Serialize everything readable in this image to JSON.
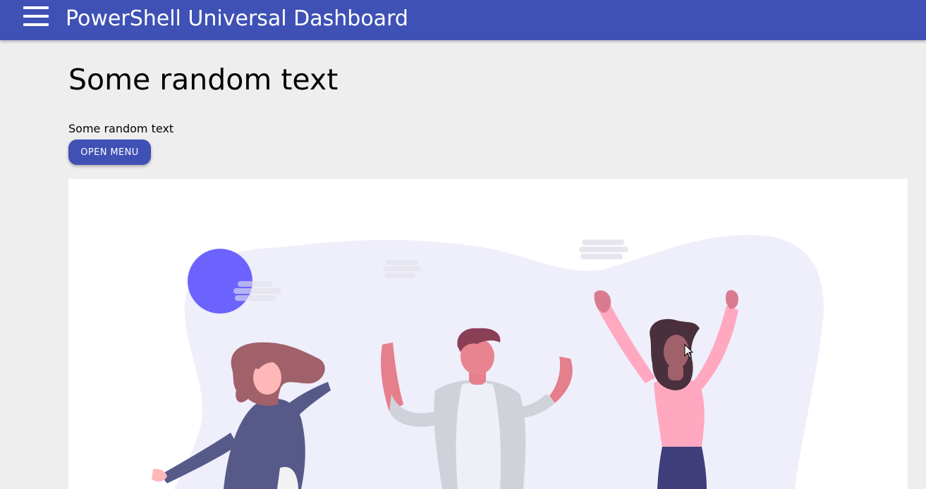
{
  "appbar": {
    "title": "PowerShell Universal Dashboard",
    "color": "#3f51b5",
    "menu_icon": "hamburger-menu-icon"
  },
  "main": {
    "heading": "Some random text",
    "paragraph": "Some random text",
    "open_menu_button": "OPEN MENU"
  },
  "illustration": {
    "name": "celebrating-people-illustration",
    "accent": "#6c63ff",
    "blob_color": "#efeefb"
  },
  "colors": {
    "background": "#eeeeee",
    "card": "#ffffff"
  }
}
